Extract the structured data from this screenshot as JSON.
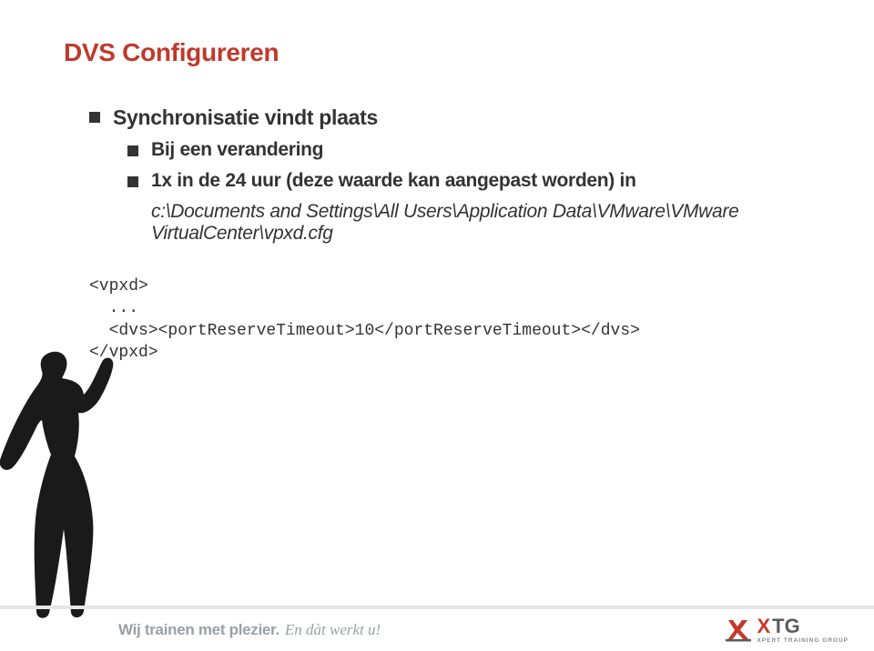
{
  "title": "DVS Configureren",
  "bullets": {
    "level1": "Synchronisatie vindt plaats",
    "level2": [
      "Bij een verandering",
      "1x in de 24 uur (deze waarde kan aangepast worden) in",
      "c:\\Documents and Settings\\All Users\\Application Data\\VMware\\VMware VirtualCenter\\vpxd.cfg"
    ]
  },
  "code": "<vpxd>\n  ...\n  <dvs><portReserveTimeout>10</portReserveTimeout></dvs>\n</vpxd>",
  "footer": {
    "tagline_bold": "Wij trainen met plezier.",
    "tagline_italic": "En dàt werkt u!",
    "logo_main_x": "X",
    "logo_main_tg": "TG",
    "logo_sub": "XPERT TRAINING GROUP"
  }
}
